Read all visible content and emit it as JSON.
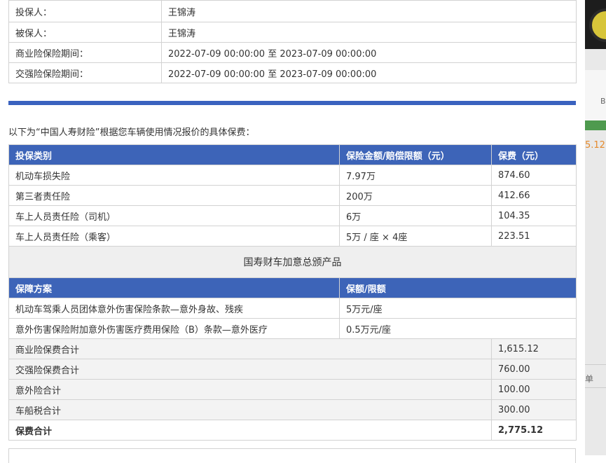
{
  "policy_info": [
    {
      "label": "投保人：",
      "value": "王锦涛"
    },
    {
      "label": "被保人：",
      "value": "王锦涛"
    },
    {
      "label": "商业险保险期间：",
      "value": "2022-07-09 00:00:00 至 2023-07-09 00:00:00"
    },
    {
      "label": "交强险保险期间：",
      "value": "2022-07-09 00:00:00 至 2023-07-09 00:00:00"
    }
  ],
  "intro": "以下为“中国人寿财险”根据您车辆使用情况报价的具体保费：",
  "coverage_table": {
    "headers": [
      "投保类别",
      "保险金额/赔偿限额（元）",
      "保费（元）"
    ],
    "rows": [
      [
        "机动车损失险",
        "7.97万",
        "874.60"
      ],
      [
        "第三者责任险",
        "200万",
        "412.66"
      ],
      [
        "车上人员责任险（司机）",
        "6万",
        "104.35"
      ],
      [
        "车上人员责任险（乘客）",
        "5万 / 座 × 4座",
        "223.51"
      ]
    ]
  },
  "accident_product": {
    "title": "国寿财车加意总颁产品",
    "headers": [
      "保障方案",
      "保额/限额"
    ],
    "rows": [
      [
        "机动车驾乘人员团体意外伤害保险条款—意外身故、残疾",
        "5万元/座"
      ],
      [
        "意外伤害保险附加意外伤害医疗费用保险（B）条款—意外医疗",
        "0.5万元/座"
      ]
    ]
  },
  "totals": [
    {
      "label": "商业险保费合计",
      "value": "1,615.12"
    },
    {
      "label": "交强险保费合计",
      "value": "760.00"
    },
    {
      "label": "意外险合计",
      "value": "100.00"
    },
    {
      "label": "车船税合计",
      "value": "300.00"
    }
  ],
  "grand_total": {
    "label": "保费合计",
    "value": "2,775.12"
  },
  "sidebar": {
    "b_text": "B",
    "amount_fragment": "5.12",
    "dan_text": "单"
  },
  "colors": {
    "header_blue": "#3d64b8",
    "accent_orange": "#e58a2c"
  }
}
